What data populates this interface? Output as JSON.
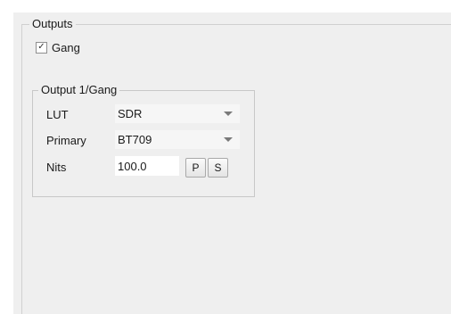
{
  "outputs_group": {
    "title": "Outputs",
    "gang": {
      "label": "Gang",
      "checked": true,
      "check_glyph": "✓"
    }
  },
  "output_group": {
    "title": "Output 1/Gang",
    "lut": {
      "label": "LUT",
      "value": "SDR"
    },
    "primary": {
      "label": "Primary",
      "value": "BT709"
    },
    "nits": {
      "label": "Nits",
      "value": "100.0",
      "p_button_label": "P",
      "s_button_label": "S"
    }
  },
  "colors": {
    "panel_background": "#efefef",
    "border": "#c8c8c8",
    "select_arrow": "#7a7a7a"
  },
  "icons": {
    "dropdown": "chevron-down-icon",
    "check": "checkmark-icon"
  }
}
